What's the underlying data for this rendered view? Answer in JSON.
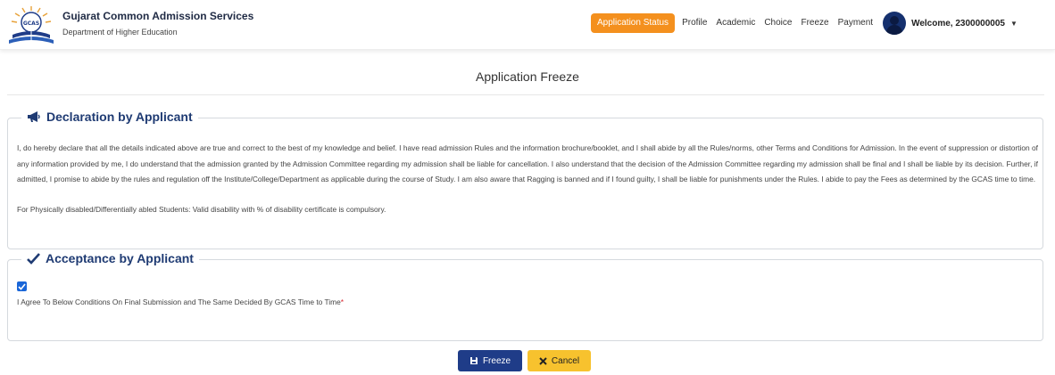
{
  "header": {
    "brand_title": "Gujarat Common Admission Services",
    "brand_subtitle": "Department of Higher Education",
    "nav": [
      {
        "label": "Application Status",
        "active": true
      },
      {
        "label": "Profile"
      },
      {
        "label": "Academic"
      },
      {
        "label": "Choice"
      },
      {
        "label": "Freeze"
      },
      {
        "label": "Payment"
      }
    ],
    "welcome": "Welcome, 2300000005",
    "icons": {
      "logo": "gcas-logo",
      "avatar": "user-avatar-icon",
      "dropdown": "caret-down-icon"
    }
  },
  "page": {
    "title": "Application Freeze"
  },
  "declaration": {
    "heading": "Declaration by Applicant",
    "icon": "megaphone-icon",
    "text": "I, do hereby declare that all the details indicated above are true and correct to the best of my knowledge and belief. I have read admission Rules and the information brochure/booklet, and I shall abide by all the Rules/norms, other Terms and Conditions for Admission. In the event of suppression or distortion of any information provided by me, I do understand that the admission granted by the Admission Committee regarding my admission shall be liable for cancellation. I also understand that the decision of the Admission Committee regarding my admission shall be final and I shall be liable by its decision. Further, if admitted, I promise to abide by the rules and regulation off the Institute/College/Department as applicable during the course of Study. I am also aware that Ragging is banned and if I found guilty, I shall be liable for punishments under the Rules. I abide to pay the Fees as determined by the GCAS time to time.",
    "note": "For Physically disabled/Differentially abled Students: Valid disability with % of disability certificate is compulsory."
  },
  "acceptance": {
    "heading": "Acceptance by Applicant",
    "icon": "checkmark-icon",
    "checked": true,
    "label": "I Agree To Below Conditions On Final Submission and The Same Decided By GCAS Time to Time",
    "required_mark": "*"
  },
  "actions": {
    "freeze_label": "Freeze",
    "cancel_label": "Cancel",
    "freeze_icon": "save-icon",
    "cancel_icon": "close-icon"
  },
  "colors": {
    "primary": "#1f3c88",
    "accent": "#f4901e",
    "warning": "#f7c22e",
    "heading": "#1f3b73"
  }
}
